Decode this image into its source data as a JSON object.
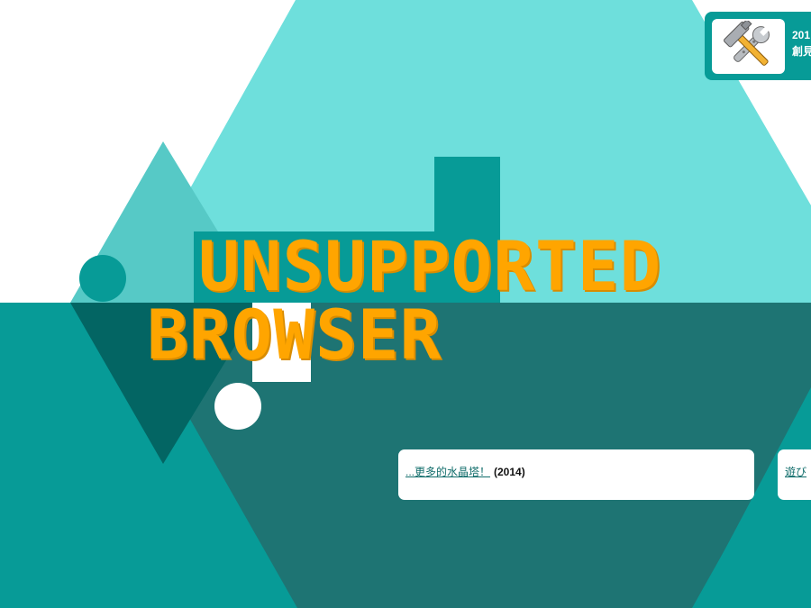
{
  "headline": {
    "line1": "UNSUPPORTED",
    "line2": "BROWSER"
  },
  "tool_badge": {
    "icon": "hammer-wrench-icon",
    "line1": "201",
    "line2": "創見"
  },
  "cards": [
    {
      "link": "...更多的水晶塔！",
      "year": "(2014)"
    },
    {
      "link": "遊び"
    }
  ],
  "colors": {
    "teal_light": "#6edfdc",
    "teal": "#079b97",
    "teal_dark": "#1e7473",
    "teal_darker": "#036563",
    "orange": "#ffa500",
    "white": "#ffffff"
  }
}
